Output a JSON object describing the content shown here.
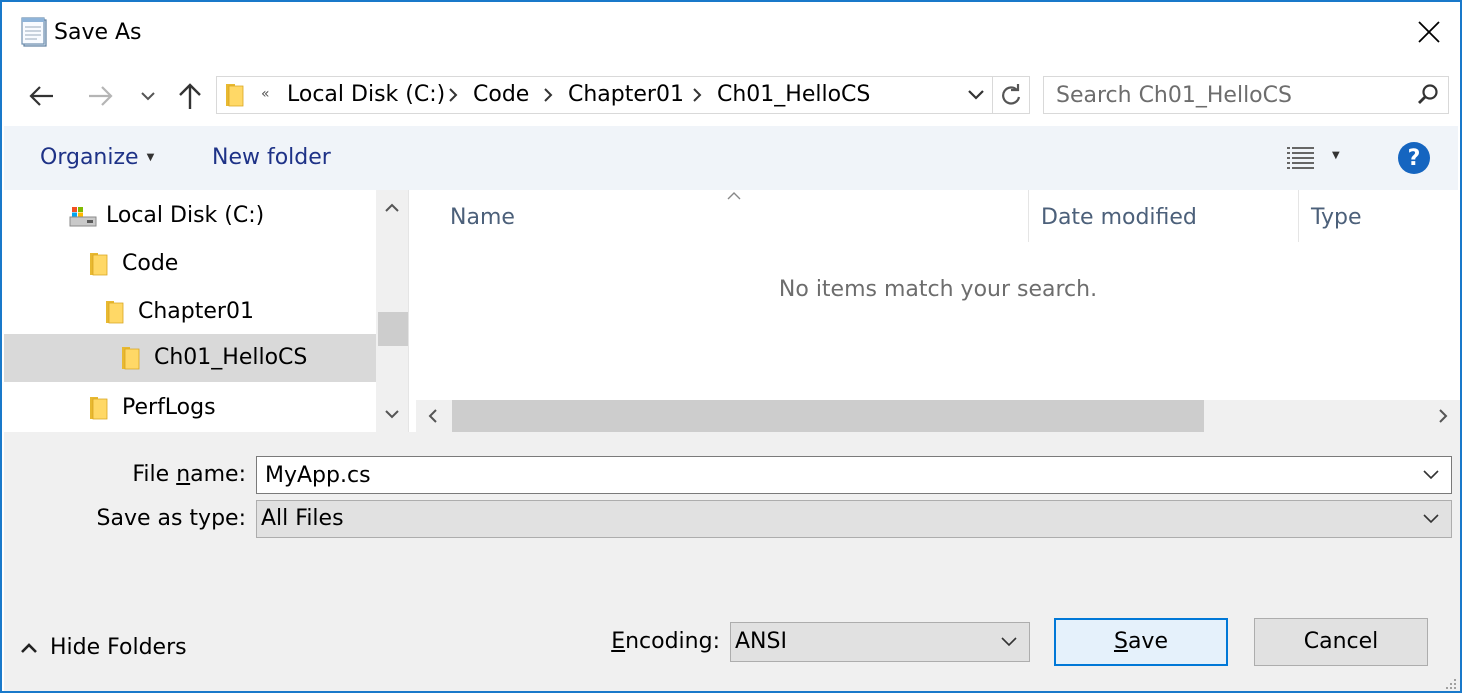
{
  "window": {
    "title": "Save As",
    "icon": "notepad-icon"
  },
  "address_bar": {
    "overflow": "«",
    "breadcrumbs": [
      "Local Disk (C:)",
      "Code",
      "Chapter01",
      "Ch01_HelloCS"
    ]
  },
  "search": {
    "placeholder": "Search Ch01_HelloCS"
  },
  "command_bar": {
    "organize_label": "Organize",
    "new_folder_label": "New folder",
    "help_label": "?"
  },
  "nav_tree": {
    "items": [
      {
        "label": "Local Disk (C:)",
        "icon": "drive-icon"
      },
      {
        "label": "Code",
        "icon": "folder-icon"
      },
      {
        "label": "Chapter01",
        "icon": "folder-icon"
      },
      {
        "label": "Ch01_HelloCS",
        "icon": "folder-icon",
        "selected": true
      },
      {
        "label": "PerfLogs",
        "icon": "folder-icon"
      }
    ]
  },
  "file_list": {
    "columns": [
      "Name",
      "Date modified",
      "Type"
    ],
    "empty_message": "No items match your search."
  },
  "form": {
    "file_name_label_pre": "File ",
    "file_name_label_ul": "n",
    "file_name_label_post": "ame:",
    "file_name_value": "MyApp.cs",
    "save_type_label": "Save as type:",
    "save_type_value": "All Files",
    "encoding_label_ul": "E",
    "encoding_label_post": "ncoding:",
    "encoding_value": "ANSI"
  },
  "buttons": {
    "hide_folders": "Hide Folders",
    "save_ul": "S",
    "save_post": "ave",
    "cancel": "Cancel"
  },
  "colors": {
    "window_border": "#1979ca",
    "link_blue": "#1e3287",
    "help_blue": "#1565c0",
    "selection": "#d9d9d9",
    "default_button_border": "#0078d7"
  }
}
